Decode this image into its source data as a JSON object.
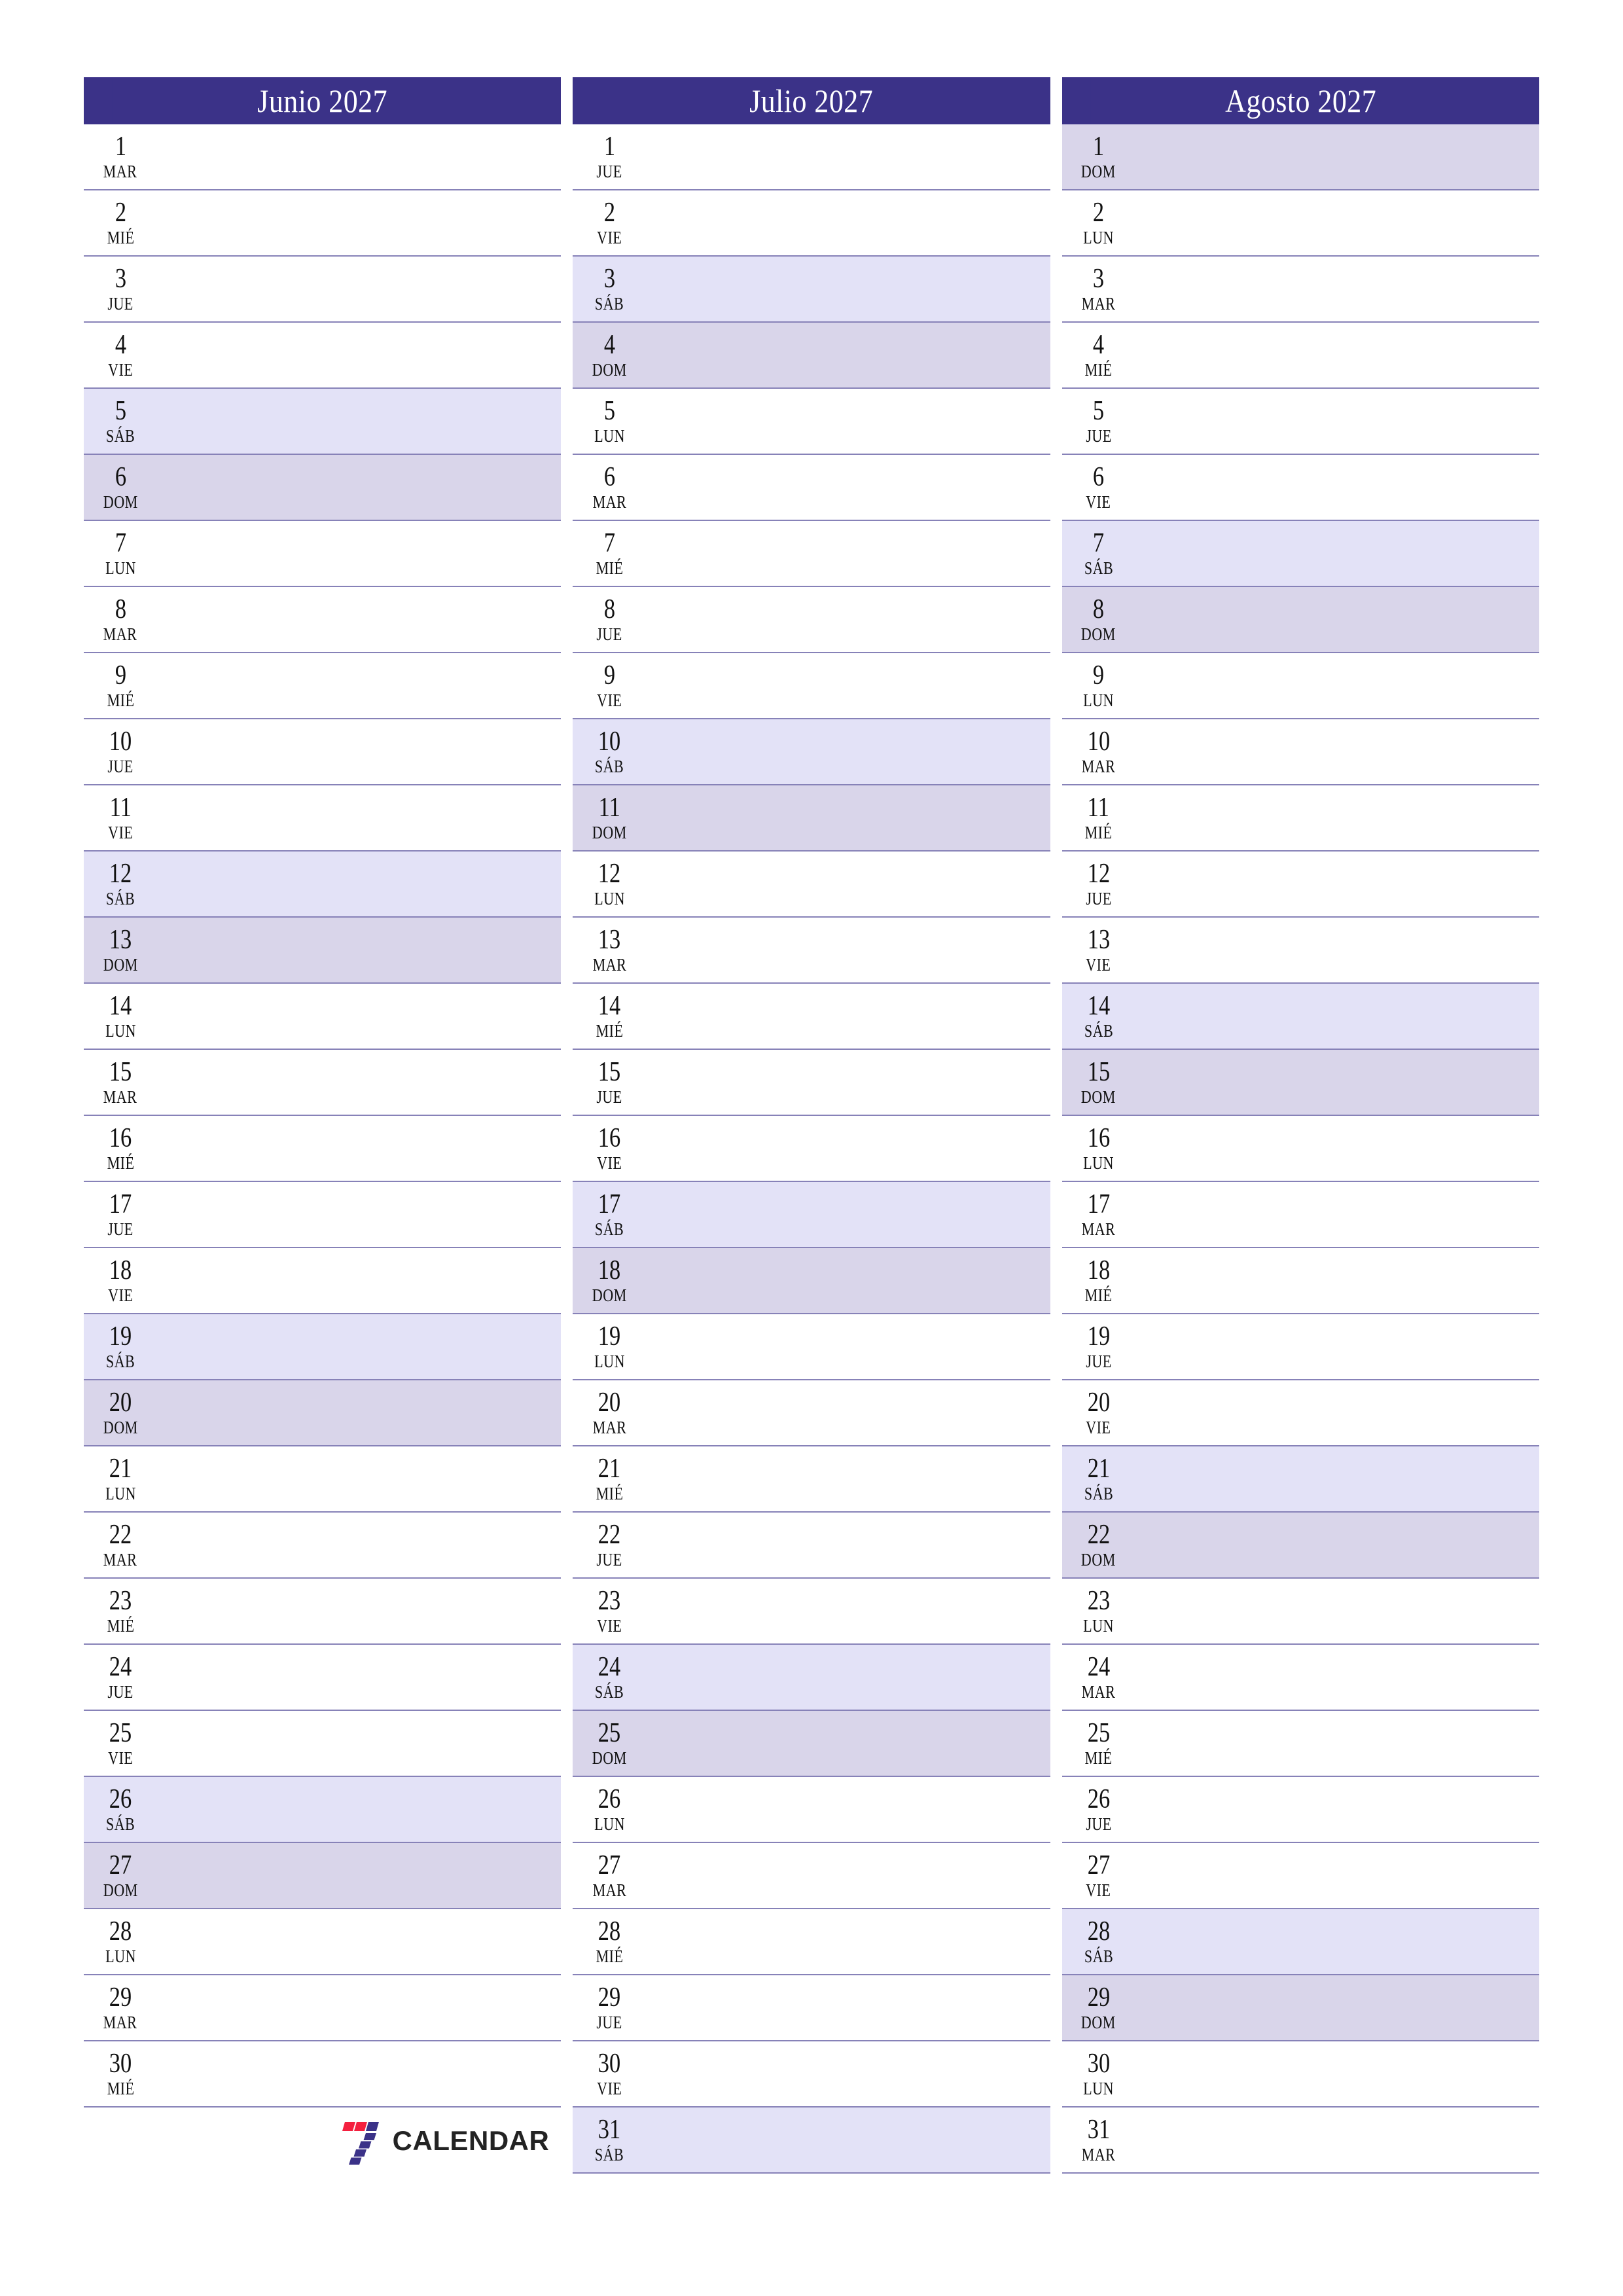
{
  "brand": {
    "name": "CALENDAR",
    "logo_icon": "seven-logo-icon",
    "colors": {
      "red": "#F4203F",
      "blue": "#3B3288",
      "word": "#232323"
    }
  },
  "theme": {
    "header_bg": "#3B3288",
    "header_text": "#FFFFFF",
    "saturday_bg": "#E3E2F7",
    "sunday_bg": "#D9D5EA",
    "row_divider": "#8782B8",
    "day_text": "#111111",
    "page_bg": "#FFFFFF"
  },
  "months": [
    {
      "title": "Junio 2027",
      "days": [
        {
          "num": "1",
          "wd": "MAR",
          "kind": "weekday"
        },
        {
          "num": "2",
          "wd": "MIÉ",
          "kind": "weekday"
        },
        {
          "num": "3",
          "wd": "JUE",
          "kind": "weekday"
        },
        {
          "num": "4",
          "wd": "VIE",
          "kind": "weekday"
        },
        {
          "num": "5",
          "wd": "SÁB",
          "kind": "sat"
        },
        {
          "num": "6",
          "wd": "DOM",
          "kind": "sun"
        },
        {
          "num": "7",
          "wd": "LUN",
          "kind": "weekday"
        },
        {
          "num": "8",
          "wd": "MAR",
          "kind": "weekday"
        },
        {
          "num": "9",
          "wd": "MIÉ",
          "kind": "weekday"
        },
        {
          "num": "10",
          "wd": "JUE",
          "kind": "weekday"
        },
        {
          "num": "11",
          "wd": "VIE",
          "kind": "weekday"
        },
        {
          "num": "12",
          "wd": "SÁB",
          "kind": "sat"
        },
        {
          "num": "13",
          "wd": "DOM",
          "kind": "sun"
        },
        {
          "num": "14",
          "wd": "LUN",
          "kind": "weekday"
        },
        {
          "num": "15",
          "wd": "MAR",
          "kind": "weekday"
        },
        {
          "num": "16",
          "wd": "MIÉ",
          "kind": "weekday"
        },
        {
          "num": "17",
          "wd": "JUE",
          "kind": "weekday"
        },
        {
          "num": "18",
          "wd": "VIE",
          "kind": "weekday"
        },
        {
          "num": "19",
          "wd": "SÁB",
          "kind": "sat"
        },
        {
          "num": "20",
          "wd": "DOM",
          "kind": "sun"
        },
        {
          "num": "21",
          "wd": "LUN",
          "kind": "weekday"
        },
        {
          "num": "22",
          "wd": "MAR",
          "kind": "weekday"
        },
        {
          "num": "23",
          "wd": "MIÉ",
          "kind": "weekday"
        },
        {
          "num": "24",
          "wd": "JUE",
          "kind": "weekday"
        },
        {
          "num": "25",
          "wd": "VIE",
          "kind": "weekday"
        },
        {
          "num": "26",
          "wd": "SÁB",
          "kind": "sat"
        },
        {
          "num": "27",
          "wd": "DOM",
          "kind": "sun"
        },
        {
          "num": "28",
          "wd": "LUN",
          "kind": "weekday"
        },
        {
          "num": "29",
          "wd": "MAR",
          "kind": "weekday"
        },
        {
          "num": "30",
          "wd": "MIÉ",
          "kind": "weekday"
        }
      ],
      "trailing_logo": true
    },
    {
      "title": "Julio 2027",
      "days": [
        {
          "num": "1",
          "wd": "JUE",
          "kind": "weekday"
        },
        {
          "num": "2",
          "wd": "VIE",
          "kind": "weekday"
        },
        {
          "num": "3",
          "wd": "SÁB",
          "kind": "sat"
        },
        {
          "num": "4",
          "wd": "DOM",
          "kind": "sun"
        },
        {
          "num": "5",
          "wd": "LUN",
          "kind": "weekday"
        },
        {
          "num": "6",
          "wd": "MAR",
          "kind": "weekday"
        },
        {
          "num": "7",
          "wd": "MIÉ",
          "kind": "weekday"
        },
        {
          "num": "8",
          "wd": "JUE",
          "kind": "weekday"
        },
        {
          "num": "9",
          "wd": "VIE",
          "kind": "weekday"
        },
        {
          "num": "10",
          "wd": "SÁB",
          "kind": "sat"
        },
        {
          "num": "11",
          "wd": "DOM",
          "kind": "sun"
        },
        {
          "num": "12",
          "wd": "LUN",
          "kind": "weekday"
        },
        {
          "num": "13",
          "wd": "MAR",
          "kind": "weekday"
        },
        {
          "num": "14",
          "wd": "MIÉ",
          "kind": "weekday"
        },
        {
          "num": "15",
          "wd": "JUE",
          "kind": "weekday"
        },
        {
          "num": "16",
          "wd": "VIE",
          "kind": "weekday"
        },
        {
          "num": "17",
          "wd": "SÁB",
          "kind": "sat"
        },
        {
          "num": "18",
          "wd": "DOM",
          "kind": "sun"
        },
        {
          "num": "19",
          "wd": "LUN",
          "kind": "weekday"
        },
        {
          "num": "20",
          "wd": "MAR",
          "kind": "weekday"
        },
        {
          "num": "21",
          "wd": "MIÉ",
          "kind": "weekday"
        },
        {
          "num": "22",
          "wd": "JUE",
          "kind": "weekday"
        },
        {
          "num": "23",
          "wd": "VIE",
          "kind": "weekday"
        },
        {
          "num": "24",
          "wd": "SÁB",
          "kind": "sat"
        },
        {
          "num": "25",
          "wd": "DOM",
          "kind": "sun"
        },
        {
          "num": "26",
          "wd": "LUN",
          "kind": "weekday"
        },
        {
          "num": "27",
          "wd": "MAR",
          "kind": "weekday"
        },
        {
          "num": "28",
          "wd": "MIÉ",
          "kind": "weekday"
        },
        {
          "num": "29",
          "wd": "JUE",
          "kind": "weekday"
        },
        {
          "num": "30",
          "wd": "VIE",
          "kind": "weekday"
        },
        {
          "num": "31",
          "wd": "SÁB",
          "kind": "sat"
        }
      ],
      "trailing_logo": false
    },
    {
      "title": "Agosto 2027",
      "days": [
        {
          "num": "1",
          "wd": "DOM",
          "kind": "sun"
        },
        {
          "num": "2",
          "wd": "LUN",
          "kind": "weekday"
        },
        {
          "num": "3",
          "wd": "MAR",
          "kind": "weekday"
        },
        {
          "num": "4",
          "wd": "MIÉ",
          "kind": "weekday"
        },
        {
          "num": "5",
          "wd": "JUE",
          "kind": "weekday"
        },
        {
          "num": "6",
          "wd": "VIE",
          "kind": "weekday"
        },
        {
          "num": "7",
          "wd": "SÁB",
          "kind": "sat"
        },
        {
          "num": "8",
          "wd": "DOM",
          "kind": "sun"
        },
        {
          "num": "9",
          "wd": "LUN",
          "kind": "weekday"
        },
        {
          "num": "10",
          "wd": "MAR",
          "kind": "weekday"
        },
        {
          "num": "11",
          "wd": "MIÉ",
          "kind": "weekday"
        },
        {
          "num": "12",
          "wd": "JUE",
          "kind": "weekday"
        },
        {
          "num": "13",
          "wd": "VIE",
          "kind": "weekday"
        },
        {
          "num": "14",
          "wd": "SÁB",
          "kind": "sat"
        },
        {
          "num": "15",
          "wd": "DOM",
          "kind": "sun"
        },
        {
          "num": "16",
          "wd": "LUN",
          "kind": "weekday"
        },
        {
          "num": "17",
          "wd": "MAR",
          "kind": "weekday"
        },
        {
          "num": "18",
          "wd": "MIÉ",
          "kind": "weekday"
        },
        {
          "num": "19",
          "wd": "JUE",
          "kind": "weekday"
        },
        {
          "num": "20",
          "wd": "VIE",
          "kind": "weekday"
        },
        {
          "num": "21",
          "wd": "SÁB",
          "kind": "sat"
        },
        {
          "num": "22",
          "wd": "DOM",
          "kind": "sun"
        },
        {
          "num": "23",
          "wd": "LUN",
          "kind": "weekday"
        },
        {
          "num": "24",
          "wd": "MAR",
          "kind": "weekday"
        },
        {
          "num": "25",
          "wd": "MIÉ",
          "kind": "weekday"
        },
        {
          "num": "26",
          "wd": "JUE",
          "kind": "weekday"
        },
        {
          "num": "27",
          "wd": "VIE",
          "kind": "weekday"
        },
        {
          "num": "28",
          "wd": "SÁB",
          "kind": "sat"
        },
        {
          "num": "29",
          "wd": "DOM",
          "kind": "sun"
        },
        {
          "num": "30",
          "wd": "LUN",
          "kind": "weekday"
        },
        {
          "num": "31",
          "wd": "MAR",
          "kind": "weekday"
        }
      ],
      "trailing_logo": false
    }
  ]
}
